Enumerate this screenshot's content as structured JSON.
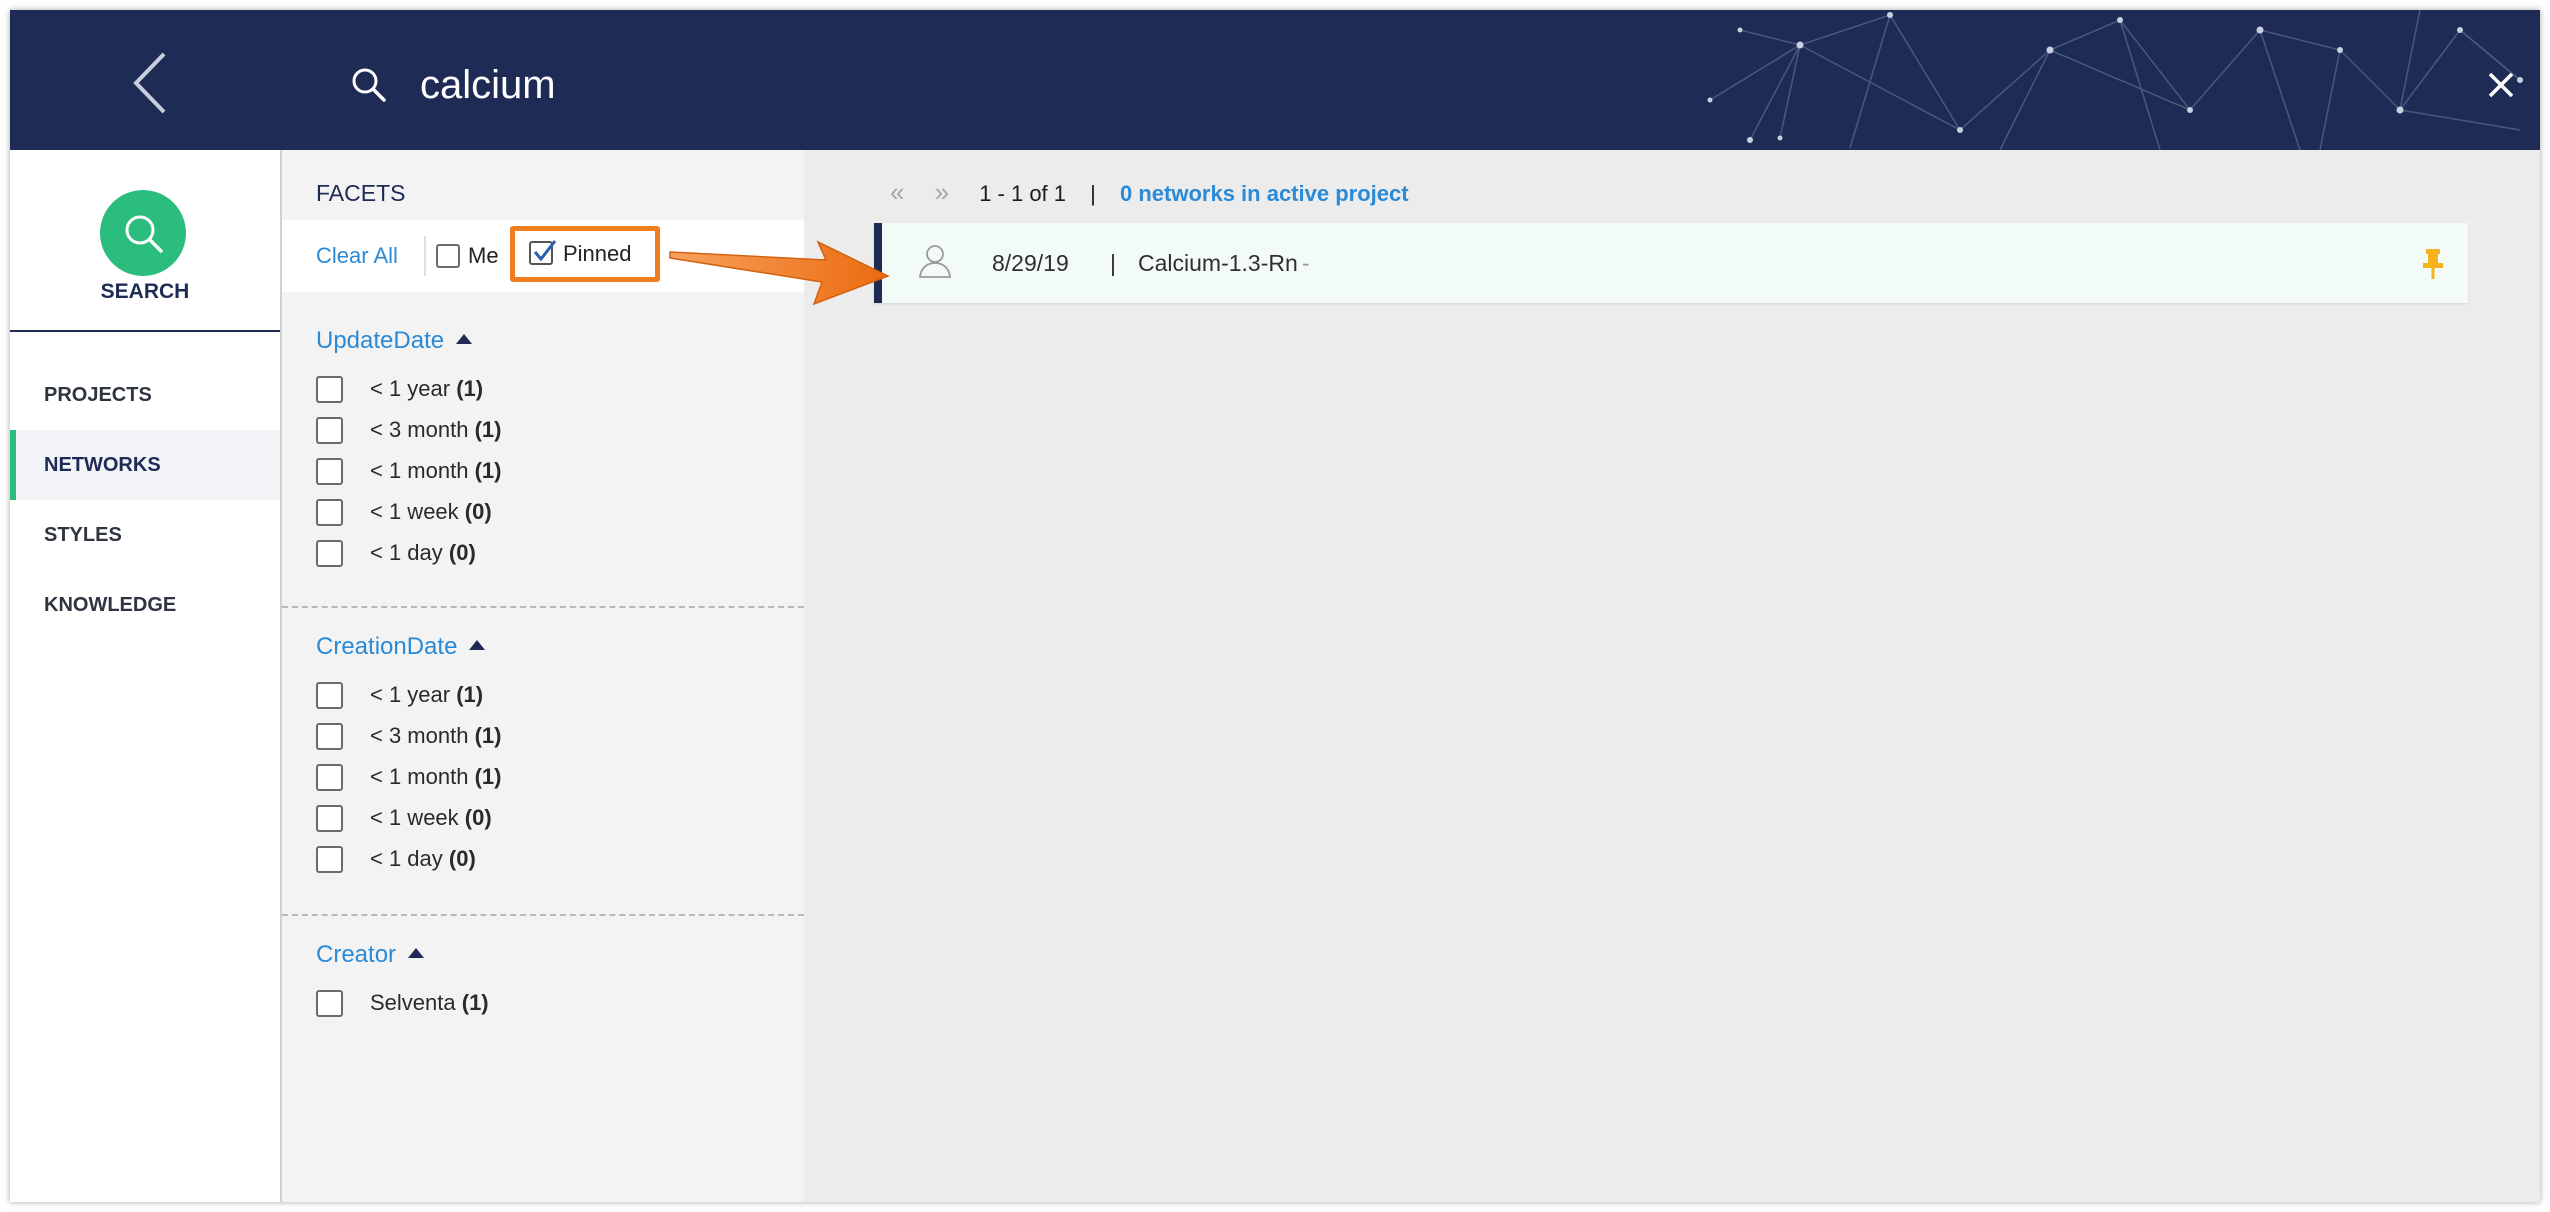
{
  "header": {
    "search_query": "calcium",
    "back_icon": "chevron-left-icon",
    "search_icon": "search-icon",
    "close_icon": "close-icon",
    "background_color": "#1e2b55"
  },
  "leftnav": {
    "search_label": "SEARCH",
    "accent_color": "#2bbd7e",
    "items": [
      {
        "label": "PROJECTS",
        "active": false
      },
      {
        "label": "NETWORKS",
        "active": true
      },
      {
        "label": "STYLES",
        "active": false
      },
      {
        "label": "KNOWLEDGE",
        "active": false
      }
    ]
  },
  "facets": {
    "title": "FACETS",
    "clear_all": "Clear All",
    "me_label": "Me",
    "me_checked": false,
    "pinned_label": "Pinned",
    "pinned_checked": true,
    "highlight_color": "#f07d1e",
    "sections": [
      {
        "title": "UpdateDate",
        "rows": [
          {
            "label": "< 1 year",
            "count": "(1)"
          },
          {
            "label": "< 3 month",
            "count": "(1)"
          },
          {
            "label": "< 1 month",
            "count": "(1)"
          },
          {
            "label": "< 1 week",
            "count": "(0)"
          },
          {
            "label": "< 1 day",
            "count": "(0)"
          }
        ]
      },
      {
        "title": "CreationDate",
        "rows": [
          {
            "label": "< 1 year",
            "count": "(1)"
          },
          {
            "label": "< 3 month",
            "count": "(1)"
          },
          {
            "label": "< 1 month",
            "count": "(1)"
          },
          {
            "label": "< 1 week",
            "count": "(0)"
          },
          {
            "label": "< 1 day",
            "count": "(0)"
          }
        ]
      },
      {
        "title": "Creator",
        "rows": [
          {
            "label": "Selventa",
            "count": "(1)"
          }
        ]
      }
    ]
  },
  "main": {
    "pager_prev": "«",
    "pager_next": "»",
    "range": "1 - 1 of 1",
    "separator": "|",
    "project_link": "0 networks in active project",
    "results": [
      {
        "date": "8/29/19",
        "separator": "|",
        "name": "Calcium-1.3-Rn",
        "suffix": "-",
        "pinned": true,
        "pin_color": "#f5b21b",
        "icon": "user-icon"
      }
    ]
  }
}
